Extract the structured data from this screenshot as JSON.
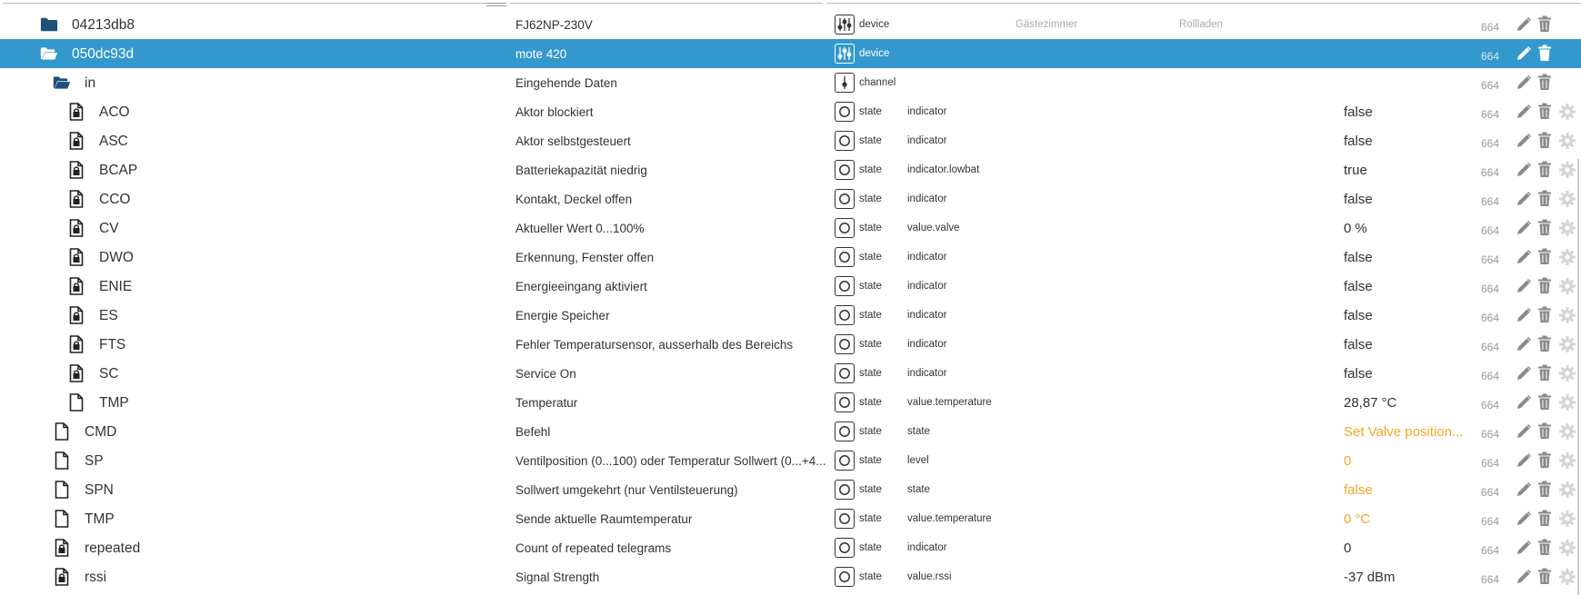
{
  "colors": {
    "selected_bg": "#3399cc",
    "acl": "#999999",
    "orange": "#f5a623"
  },
  "rows": [
    {
      "level": 0,
      "icon": "folder-closed-icon",
      "id": "04213db8",
      "name": "FJ62NP-230V",
      "type_icon": "device-icon",
      "type": "device",
      "role": "",
      "room": "Gästezimmer",
      "func": "Rollladen",
      "value": "",
      "unit": "",
      "value_orange": false,
      "acl": "664",
      "selected": false,
      "gear": false
    },
    {
      "level": 0,
      "icon": "folder-open-icon",
      "id": "050dc93d",
      "name": "mote 420",
      "type_icon": "device-icon",
      "type": "device",
      "role": "",
      "room": "",
      "func": "",
      "value": "",
      "unit": "",
      "value_orange": false,
      "acl": "664",
      "selected": true,
      "gear": false
    },
    {
      "level": 1,
      "icon": "folder-open-icon",
      "id": "in",
      "name": "Eingehende Daten",
      "type_icon": "channel-icon",
      "type": "channel",
      "role": "",
      "room": "",
      "func": "",
      "value": "",
      "unit": "",
      "value_orange": false,
      "acl": "664",
      "selected": false,
      "gear": false
    },
    {
      "level": 2,
      "icon": "file-lock-icon",
      "id": "ACO",
      "name": "Aktor blockiert",
      "type_icon": "state-icon",
      "type": "state",
      "role": "indicator",
      "room": "",
      "func": "",
      "value": "false",
      "unit": "",
      "value_orange": false,
      "acl": "664",
      "selected": false,
      "gear": true
    },
    {
      "level": 2,
      "icon": "file-lock-icon",
      "id": "ASC",
      "name": "Aktor selbstgesteuert",
      "type_icon": "state-icon",
      "type": "state",
      "role": "indicator",
      "room": "",
      "func": "",
      "value": "false",
      "unit": "",
      "value_orange": false,
      "acl": "664",
      "selected": false,
      "gear": true
    },
    {
      "level": 2,
      "icon": "file-lock-icon",
      "id": "BCAP",
      "name": "Batteriekapazität niedrig",
      "type_icon": "state-icon",
      "type": "state",
      "role": "indicator.lowbat",
      "room": "",
      "func": "",
      "value": "true",
      "unit": "",
      "value_orange": false,
      "acl": "664",
      "selected": false,
      "gear": true
    },
    {
      "level": 2,
      "icon": "file-lock-icon",
      "id": "CCO",
      "name": "Kontakt, Deckel offen",
      "type_icon": "state-icon",
      "type": "state",
      "role": "indicator",
      "room": "",
      "func": "",
      "value": "false",
      "unit": "",
      "value_orange": false,
      "acl": "664",
      "selected": false,
      "gear": true
    },
    {
      "level": 2,
      "icon": "file-lock-icon",
      "id": "CV",
      "name": "Aktueller Wert 0...100%",
      "type_icon": "state-icon",
      "type": "state",
      "role": "value.valve",
      "room": "",
      "func": "",
      "value": "0",
      "unit": "%",
      "value_orange": false,
      "acl": "664",
      "selected": false,
      "gear": true
    },
    {
      "level": 2,
      "icon": "file-lock-icon",
      "id": "DWO",
      "name": "Erkennung, Fenster offen",
      "type_icon": "state-icon",
      "type": "state",
      "role": "indicator",
      "room": "",
      "func": "",
      "value": "false",
      "unit": "",
      "value_orange": false,
      "acl": "664",
      "selected": false,
      "gear": true
    },
    {
      "level": 2,
      "icon": "file-lock-icon",
      "id": "ENIE",
      "name": "Energieeingang aktiviert",
      "type_icon": "state-icon",
      "type": "state",
      "role": "indicator",
      "room": "",
      "func": "",
      "value": "false",
      "unit": "",
      "value_orange": false,
      "acl": "664",
      "selected": false,
      "gear": true
    },
    {
      "level": 2,
      "icon": "file-lock-icon",
      "id": "ES",
      "name": "Energie Speicher",
      "type_icon": "state-icon",
      "type": "state",
      "role": "indicator",
      "room": "",
      "func": "",
      "value": "false",
      "unit": "",
      "value_orange": false,
      "acl": "664",
      "selected": false,
      "gear": true
    },
    {
      "level": 2,
      "icon": "file-lock-icon",
      "id": "FTS",
      "name": "Fehler Temperatursensor, ausserhalb des Bereichs",
      "type_icon": "state-icon",
      "type": "state",
      "role": "indicator",
      "room": "",
      "func": "",
      "value": "false",
      "unit": "",
      "value_orange": false,
      "acl": "664",
      "selected": false,
      "gear": true
    },
    {
      "level": 2,
      "icon": "file-lock-icon",
      "id": "SC",
      "name": "Service On",
      "type_icon": "state-icon",
      "type": "state",
      "role": "indicator",
      "room": "",
      "func": "",
      "value": "false",
      "unit": "",
      "value_orange": false,
      "acl": "664",
      "selected": false,
      "gear": true
    },
    {
      "level": 2,
      "icon": "file-icon",
      "id": "TMP",
      "name": "Temperatur",
      "type_icon": "state-icon",
      "type": "state",
      "role": "value.temperature",
      "room": "",
      "func": "",
      "value": "28,87",
      "unit": "°C",
      "value_orange": false,
      "acl": "664",
      "selected": false,
      "gear": true
    },
    {
      "level": 1,
      "icon": "file-icon",
      "id": "CMD",
      "name": "Befehl",
      "type_icon": "state-icon",
      "type": "state",
      "role": "state",
      "room": "",
      "func": "",
      "value": "Set Valve position...",
      "unit": "",
      "value_orange": true,
      "acl": "664",
      "selected": false,
      "gear": true
    },
    {
      "level": 1,
      "icon": "file-icon",
      "id": "SP",
      "name": "Ventilposition (0...100) oder Temperatur Sollwert (0...+4...",
      "type_icon": "state-icon",
      "type": "state",
      "role": "level",
      "room": "",
      "func": "",
      "value": "0",
      "unit": "",
      "value_orange": true,
      "acl": "664",
      "selected": false,
      "gear": true
    },
    {
      "level": 1,
      "icon": "file-icon",
      "id": "SPN",
      "name": "Sollwert umgekehrt (nur Ventilsteuerung)",
      "type_icon": "state-icon",
      "type": "state",
      "role": "state",
      "room": "",
      "func": "",
      "value": "false",
      "unit": "",
      "value_orange": true,
      "acl": "664",
      "selected": false,
      "gear": true
    },
    {
      "level": 1,
      "icon": "file-icon",
      "id": "TMP",
      "name": "Sende aktuelle Raumtemperatur",
      "type_icon": "state-icon",
      "type": "state",
      "role": "value.temperature",
      "room": "",
      "func": "",
      "value": "0",
      "unit": "°C",
      "value_orange": true,
      "acl": "664",
      "selected": false,
      "gear": true
    },
    {
      "level": 1,
      "icon": "file-lock-icon",
      "id": "repeated",
      "name": "Count of repeated telegrams",
      "type_icon": "state-icon",
      "type": "state",
      "role": "indicator",
      "room": "",
      "func": "",
      "value": "0",
      "unit": "",
      "value_orange": false,
      "acl": "664",
      "selected": false,
      "gear": true
    },
    {
      "level": 1,
      "icon": "file-lock-icon",
      "id": "rssi",
      "name": "Signal Strength",
      "type_icon": "state-icon",
      "type": "state",
      "role": "value.rssi",
      "room": "",
      "func": "",
      "value": "-37",
      "unit": "dBm",
      "value_orange": false,
      "acl": "664",
      "selected": false,
      "gear": true
    }
  ]
}
